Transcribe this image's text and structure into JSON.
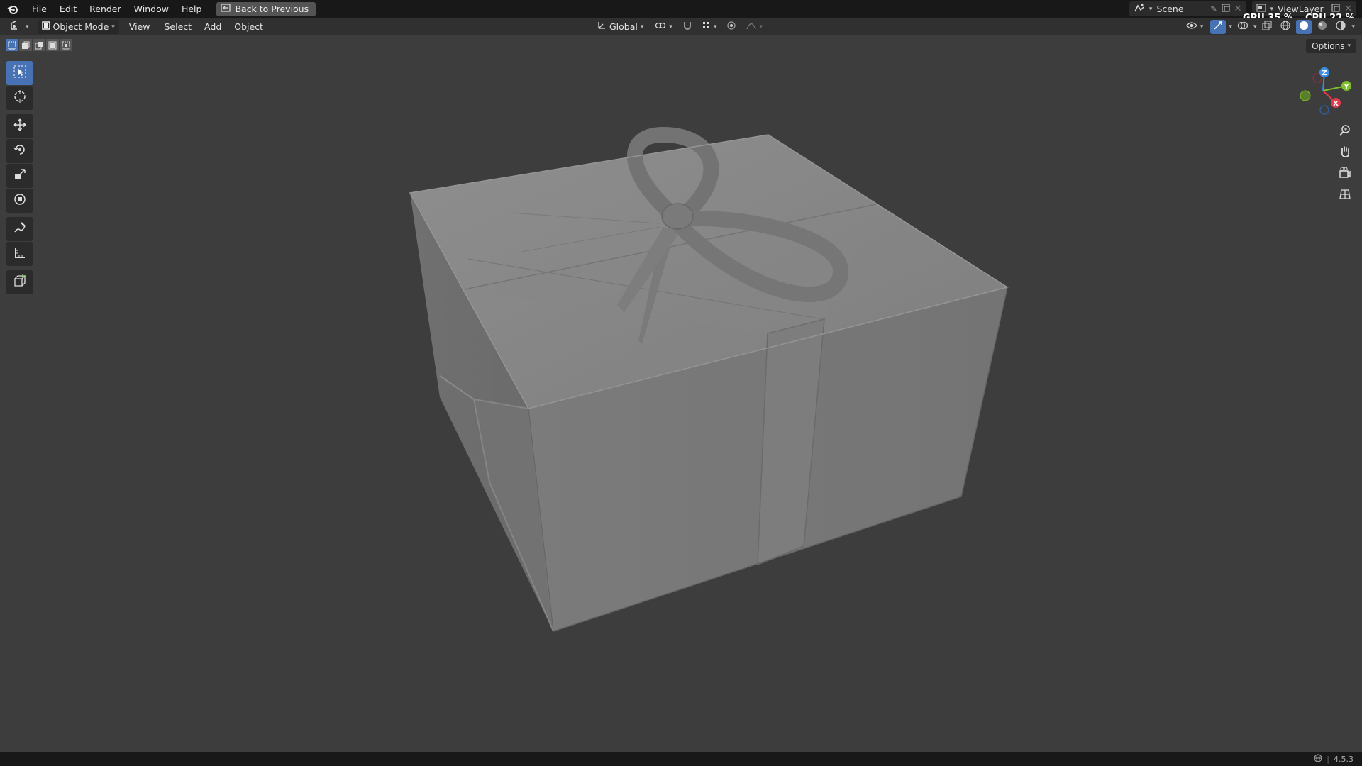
{
  "menu": {
    "items": [
      "File",
      "Edit",
      "Render",
      "Window",
      "Help"
    ],
    "back_button": "Back to Previous"
  },
  "scene": {
    "name": "Scene",
    "view_layer": "ViewLayer"
  },
  "stats": {
    "gpu": "GPU 35 %",
    "cpu": "CPU 22 %"
  },
  "header": {
    "mode": "Object Mode",
    "menus": [
      "View",
      "Select",
      "Add",
      "Object"
    ],
    "transform_orientation": "Global"
  },
  "options_label": "Options",
  "tools": [
    "select-box",
    "cursor",
    "move",
    "rotate",
    "scale",
    "transform",
    "annotate",
    "measure",
    "add-cube"
  ],
  "gizmo": {
    "x_label": "X",
    "y_label": "Y",
    "z_label": "Z"
  },
  "status": {
    "version": "4.5.3"
  },
  "colors": {
    "accent": "#4772b3",
    "x_axis": "#e23b4e",
    "y_axis": "#7fbf2f",
    "z_axis": "#3a8ee6",
    "background": "#3d3d3d"
  }
}
